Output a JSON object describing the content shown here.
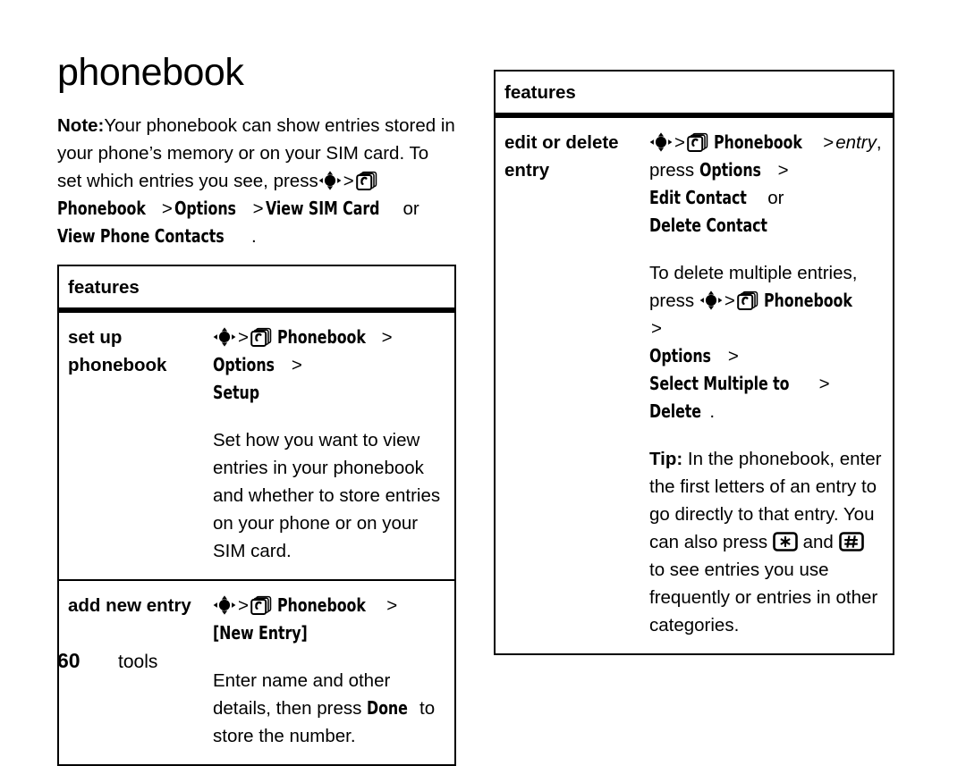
{
  "page": {
    "title": "phonebook",
    "folio": "60",
    "running_head": "tools"
  },
  "note": {
    "label": "Note:",
    "text_1": "Your phonebook can show entries stored in your phone’s memory or on your SIM card. To set which entries you see, press",
    "ui_phonebook": "Phonebook",
    "ui_options": "Options",
    "gt": ">",
    "ui_view_sim_card": "View SIM Card",
    "or": "or",
    "ui_view_phone_contacts": "View Phone Contacts",
    "period": "."
  },
  "icons": {
    "nav_key": "navigation-key-icon",
    "phonebook": "phonebook-icon",
    "star_key": "star-key-icon",
    "pound_key": "pound-key-icon"
  },
  "left_table": {
    "header": "features",
    "rows": [
      {
        "term": "set up phonebook",
        "path_prefix": ">",
        "ui_phonebook": "Phonebook",
        "ui_options": "Options",
        "ui_setup": "Setup",
        "body": "Set how you want to view entries in your phonebook and whether to store entries on your phone or on your SIM card."
      },
      {
        "term": "add new entry",
        "ui_phonebook": "Phonebook",
        "ui_new_entry": "[New Entry]",
        "body_1": "Enter name and other details, then press",
        "ui_done": "Done",
        "body_2": "to store the number."
      }
    ]
  },
  "right_table": {
    "header": "features",
    "rows": [
      {
        "term": "edit or delete entry",
        "ui_phonebook": "Phonebook",
        "entry_italic": "entry",
        "comma": ",",
        "press": "press",
        "ui_options": "Options",
        "ui_edit_contact": "Edit Contact",
        "or": "or",
        "ui_delete_contact": "Delete Contact",
        "delete_multi_1": "To delete multiple entries,",
        "delete_multi_press": "press",
        "ui_options_2": "Options",
        "ui_select_multiple_to": "Select Multiple to",
        "ui_delete": "Delete",
        "period": ".",
        "tip_label": "Tip:",
        "tip_text_1": "In the phonebook, enter the first letters of an entry to go directly to that entry. You can also press",
        "tip_and": "and",
        "tip_text_2": "to see entries you use frequently or entries in other categories."
      }
    ]
  },
  "colors": {
    "ink": "#000000",
    "paper": "#ffffff"
  }
}
